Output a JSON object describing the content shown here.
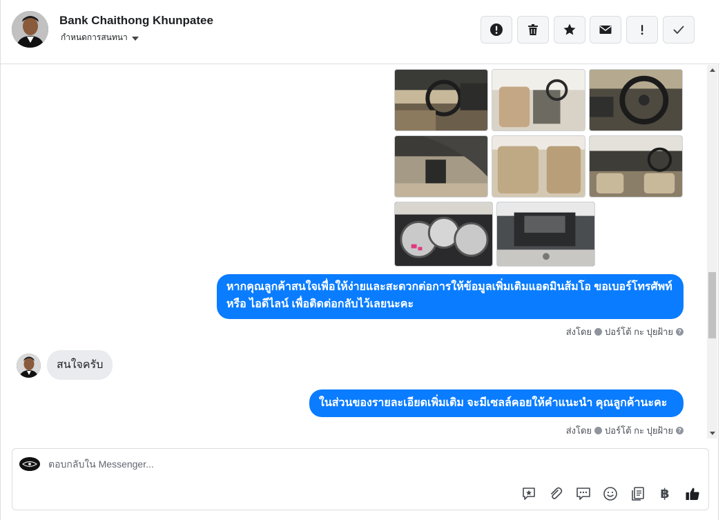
{
  "header": {
    "contact_name": "Bank Chaithong Khunpatee",
    "assign_label": "กำหนดการสนทนา",
    "actions": [
      {
        "name": "mark-spam-button",
        "icon": "alert-circle-icon"
      },
      {
        "name": "delete-button",
        "icon": "trash-icon"
      },
      {
        "name": "star-button",
        "icon": "star-icon"
      },
      {
        "name": "mark-unread-button",
        "icon": "envelope-icon"
      },
      {
        "name": "follow-up-button",
        "icon": "exclamation-icon"
      },
      {
        "name": "mark-done-button",
        "icon": "checkmark-icon"
      }
    ]
  },
  "conversation": {
    "messages": [
      {
        "direction": "outgoing",
        "type": "photos",
        "count": 8
      },
      {
        "direction": "outgoing",
        "type": "text",
        "text": "หากคุณลูกค้าสนใจเพื่อให้ง่ายและสะดวกต่อการให้ข้อมูลเพิ่มเติมแอดมินส้มโอ ขอเบอร์โทรศัพท์ หรือ ไอดีไลน์ เพื่อติดต่อกลับไว้เลยนะคะ"
      },
      {
        "direction": "incoming",
        "type": "text",
        "text": "สนใจครับ"
      },
      {
        "direction": "outgoing",
        "type": "text",
        "text": "ในส่วนของรายละเอียดเพิ่มเติม จะมีเซลล์คอยให้คำแนะนำ คุณลูกค้านะคะ"
      }
    ],
    "sent_by": {
      "prefix": "ส่งโดย",
      "agent": "ปอร์โต้ กะ ปุยฝ้าย",
      "help": "?"
    }
  },
  "composer": {
    "placeholder": "ตอบกลับใน Messenger...",
    "tools": [
      "saved-reply-icon",
      "attachment-icon",
      "quick-reply-icon",
      "emoji-icon",
      "catalog-icon",
      "payment-icon",
      "like-icon"
    ],
    "currency_symbol": "฿"
  },
  "colors": {
    "outgoing_bubble": "#0a7cff",
    "incoming_bubble": "#e9ebee",
    "border": "#dadde1"
  }
}
